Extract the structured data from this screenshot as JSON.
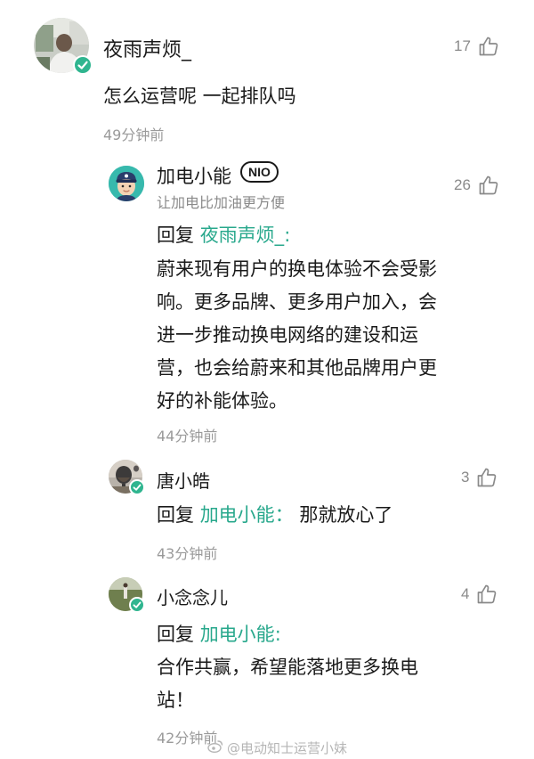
{
  "comments": [
    {
      "username": "夜雨声烦_",
      "likes": "17",
      "text": "怎么运营呢 一起排队吗",
      "time": "49分钟前"
    },
    {
      "username": "加电小能",
      "badge": "NIO",
      "subtitle": "让加电比加油更方便",
      "likes": "26",
      "reply_prefix": "回复 ",
      "reply_to": "夜雨声烦_",
      "reply_colon": ":",
      "lines": [
        "蔚来现有用户的换电体验不会受影",
        "响。更多品牌、更多用户加入，会",
        "进一步推动换电网络的建设和运",
        "营，也会给蔚来和其他品牌用户更",
        "好的补能体验。"
      ],
      "time": "44分钟前"
    },
    {
      "username": "唐小皓",
      "likes": "3",
      "reply_prefix": "回复 ",
      "reply_to": "加电小能",
      "reply_colon": "：",
      "reply_text": " 那就放心了",
      "time": "43分钟前"
    },
    {
      "username": "小念念儿",
      "likes": "4",
      "reply_prefix": "回复 ",
      "reply_to": "加电小能",
      "reply_colon": ":",
      "lines": [
        "合作共赢，希望能落地更多换电",
        "站！"
      ],
      "time": "42分钟前"
    }
  ],
  "watermark": "@电动知士运营小妹",
  "colors": {
    "reply_name": "#28a88c",
    "verified": "#2fb58f",
    "meta_gray": "#9a9a9a"
  },
  "icons": {
    "like": "thumbs-up-icon",
    "verified": "verified-check-icon",
    "weibo": "weibo-logo-icon"
  }
}
